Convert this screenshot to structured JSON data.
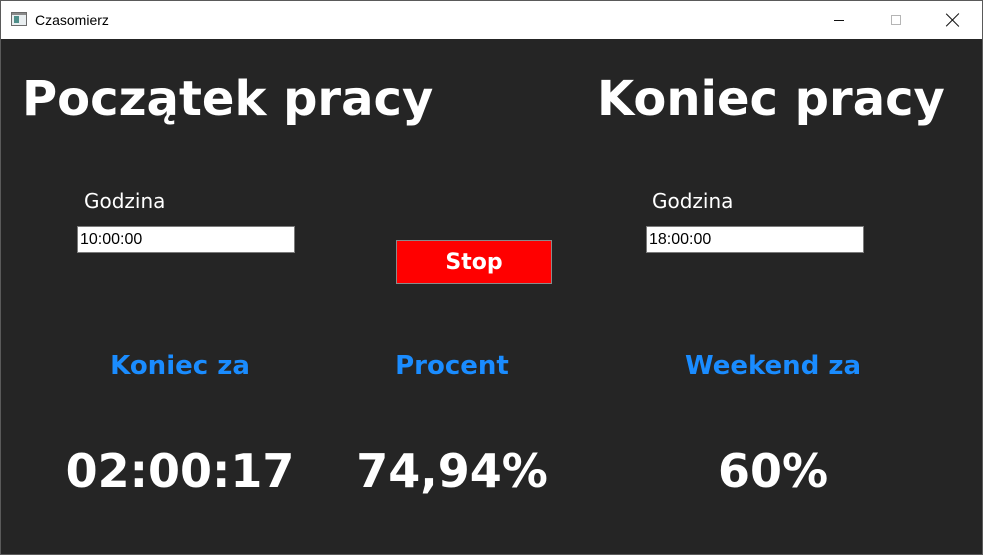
{
  "window": {
    "title": "Czasomierz",
    "icon": "app-window-icon",
    "controls": {
      "minimize": "minimize-icon",
      "maximize": "maximize-icon",
      "close": "close-icon"
    }
  },
  "start": {
    "heading": "Początek pracy",
    "label": "Godzina",
    "value": "10:00:00"
  },
  "end": {
    "heading": "Koniec pracy",
    "label": "Godzina",
    "value": "18:00:00"
  },
  "actions": {
    "stop_label": "Stop",
    "stop_color": "#ff0000"
  },
  "stats": {
    "end_in": {
      "label": "Koniec za",
      "value": "02:00:17"
    },
    "percent": {
      "label": "Procent",
      "value": "74,94%"
    },
    "weekend_in": {
      "label": "Weekend za",
      "value": "60%"
    },
    "label_color": "#1a8cff"
  }
}
